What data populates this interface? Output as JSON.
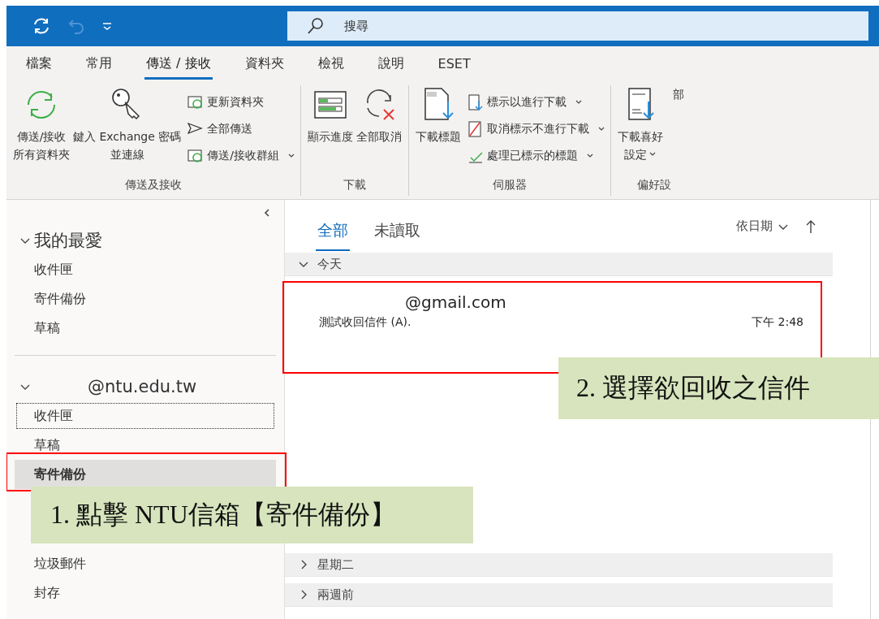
{
  "title_bar": {
    "search": {
      "placeholder": "搜尋"
    }
  },
  "ribbon": {
    "tabs": [
      {
        "label": "檔案",
        "selected": false
      },
      {
        "label": "常用",
        "selected": false
      },
      {
        "label": "傳送 / 接收",
        "selected": true
      },
      {
        "label": "資料夾",
        "selected": false
      },
      {
        "label": "檢視",
        "selected": false
      },
      {
        "label": "說明",
        "selected": false
      },
      {
        "label": "ESET",
        "selected": false
      }
    ],
    "groups": [
      {
        "label": "傳送及接收",
        "items": [
          {
            "kind": "large",
            "lines": [
              "傳送/接收",
              "所有資料夾"
            ],
            "dropdown": false
          },
          {
            "kind": "large",
            "lines": [
              "鍵入 Exchange 密碼",
              "並連線"
            ],
            "dropdown": false
          },
          {
            "kind": "small",
            "label": "更新資料夾",
            "dropdown": false
          },
          {
            "kind": "small",
            "label": "全部傳送",
            "dropdown": false
          },
          {
            "kind": "small",
            "label": "傳送/接收群組",
            "dropdown": true
          }
        ]
      },
      {
        "label": "下載",
        "items": [
          {
            "kind": "large",
            "lines": [
              "顯示進度"
            ],
            "dropdown": false
          },
          {
            "kind": "large",
            "lines": [
              "全部取消"
            ],
            "dropdown": false
          }
        ]
      },
      {
        "label": "伺服器",
        "items": [
          {
            "kind": "large",
            "lines": [
              "下載標題"
            ],
            "dropdown": false
          },
          {
            "kind": "small",
            "label": "標示以進行下載",
            "dropdown": true
          },
          {
            "kind": "small",
            "label": "取消標示不進行下載",
            "dropdown": true
          },
          {
            "kind": "small",
            "label": "處理已標示的標題",
            "dropdown": true
          }
        ]
      },
      {
        "label": "偏好設",
        "items": [
          {
            "kind": "large",
            "lines": [
              "下載喜好",
              "設定"
            ],
            "dropdown": true
          },
          {
            "kind": "large",
            "lines": [
              "部"
            ],
            "dropdown": false
          }
        ]
      }
    ]
  },
  "folder_pane": {
    "sections": [
      {
        "title": "我的最愛",
        "expanded": true,
        "folders": [
          {
            "label": "收件匣",
            "selected": false,
            "focused": false
          },
          {
            "label": "寄件備份",
            "selected": false,
            "focused": false
          },
          {
            "label": "草稿",
            "selected": false,
            "focused": false
          }
        ]
      },
      {
        "title": "@ntu.edu.tw",
        "expanded": true,
        "folders": [
          {
            "label": "收件匣",
            "selected": false,
            "focused": true
          },
          {
            "label": "草稿",
            "selected": false,
            "focused": false
          },
          {
            "label": "寄件備份",
            "selected": true,
            "focused": false
          },
          {
            "label": "垃圾郵件",
            "selected": false,
            "focused": false
          },
          {
            "label": "封存",
            "selected": false,
            "focused": false
          }
        ]
      }
    ]
  },
  "message_list": {
    "tabs": [
      {
        "label": "全部",
        "selected": true
      },
      {
        "label": "未讀取",
        "selected": false
      }
    ],
    "sort": {
      "label": "依日期"
    },
    "groups": [
      {
        "label": "今天",
        "expanded": true,
        "messages": [
          {
            "sender": "@gmail.com",
            "subject": "測試收回信件 (A).",
            "time": "下午 2:48"
          }
        ]
      },
      {
        "label": "星期二",
        "expanded": false
      },
      {
        "label": "兩週前",
        "expanded": false
      }
    ]
  },
  "annotations": [
    {
      "text": "2. 選擇欲回收之信件"
    },
    {
      "text": "1. 點擊 NTU信箱【寄件備份】"
    }
  ]
}
